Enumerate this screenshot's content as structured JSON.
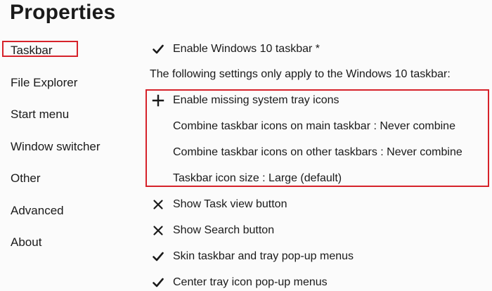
{
  "title": "Properties",
  "sidebar": {
    "items": [
      {
        "label": "Taskbar",
        "selected": true
      },
      {
        "label": "File Explorer"
      },
      {
        "label": "Start menu"
      },
      {
        "label": "Window switcher"
      },
      {
        "label": "Other"
      },
      {
        "label": "Advanced"
      },
      {
        "label": "About"
      }
    ]
  },
  "main": {
    "enable_taskbar": {
      "label": "Enable Windows 10 taskbar *",
      "icon": "checkmark-icon"
    },
    "info": "The following settings only apply to the Windows 10 taskbar:",
    "settings": [
      {
        "label": "Enable missing system tray icons",
        "icon": "plus-icon"
      },
      {
        "label": "Combine taskbar icons on main taskbar : Never combine",
        "icon": ""
      },
      {
        "label": "Combine taskbar icons on other taskbars : Never combine",
        "icon": ""
      },
      {
        "label": "Taskbar icon size : Large (default)",
        "icon": ""
      },
      {
        "label": "Show Task view button",
        "icon": "x-icon"
      },
      {
        "label": "Show Search button",
        "icon": "x-icon"
      },
      {
        "label": "Skin taskbar and tray pop-up menus",
        "icon": "checkmark-icon"
      },
      {
        "label": "Center tray icon pop-up menus",
        "icon": "checkmark-icon"
      }
    ]
  },
  "colors": {
    "highlight": "#d6222a",
    "background": "#fbfbfb",
    "text": "#1a1a1a"
  }
}
